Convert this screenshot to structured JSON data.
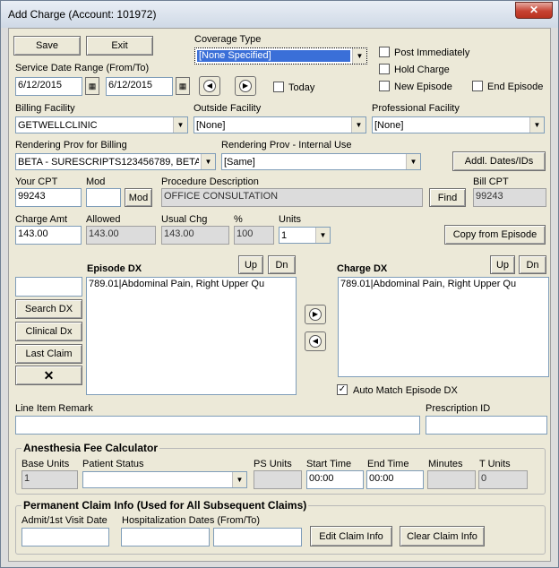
{
  "window": {
    "title": "Add Charge (Account: 101972)",
    "close_label": "✕"
  },
  "toolbar": {
    "save_label": "Save",
    "exit_label": "Exit"
  },
  "service_date": {
    "label": "Service Date Range (From/To)",
    "from": "6/12/2015",
    "to": "6/12/2015",
    "today_label": "Today"
  },
  "coverage": {
    "label": "Coverage Type",
    "value": "[None Specified]"
  },
  "options": {
    "post_immediately": "Post Immediately",
    "hold_charge": "Hold Charge",
    "new_episode": "New Episode",
    "end_episode": "End Episode"
  },
  "facilities": {
    "billing_label": "Billing Facility",
    "billing_value": "GETWELLCLINIC",
    "outside_label": "Outside Facility",
    "outside_value": "[None]",
    "professional_label": "Professional Facility",
    "professional_value": "[None]"
  },
  "rendering": {
    "billing_label": "Rendering Prov for Billing",
    "billing_value": "BETA - SURESCRIPTS123456789, BETA",
    "internal_label": "Rendering Prov - Internal Use",
    "internal_value": "[Same]",
    "addl_button": "Addl. Dates/IDs"
  },
  "cpt": {
    "your_cpt_label": "Your CPT",
    "your_cpt_value": "99243",
    "mod_label": "Mod",
    "mod_value": "",
    "mod_button": "Mod",
    "desc_label": "Procedure Description",
    "desc_value": "OFFICE CONSULTATION",
    "find_button": "Find",
    "bill_cpt_label": "Bill CPT",
    "bill_cpt_value": "99243"
  },
  "amounts": {
    "charge_label": "Charge Amt",
    "charge_value": "143.00",
    "allowed_label": "Allowed",
    "allowed_value": "143.00",
    "usual_label": "Usual Chg",
    "usual_value": "143.00",
    "pct_label": "%",
    "pct_value": "100",
    "units_label": "Units",
    "units_value": "1",
    "copy_button": "Copy from Episode"
  },
  "episode_dx": {
    "label": "Episode DX",
    "up": "Up",
    "dn": "Dn",
    "items": [
      "789.01|Abdominal Pain, Right Upper Qu"
    ]
  },
  "charge_dx": {
    "label": "Charge DX",
    "up": "Up",
    "dn": "Dn",
    "items": [
      "789.01|Abdominal Pain, Right Upper Qu"
    ],
    "auto_match_label": "Auto Match Episode DX"
  },
  "dx_buttons": {
    "search": "Search DX",
    "clinical": "Clinical Dx",
    "last_claim": "Last Claim",
    "delete": "✕",
    "search_value": ""
  },
  "remarks": {
    "line_item_label": "Line Item Remark",
    "line_item_value": "",
    "prescription_label": "Prescription ID",
    "prescription_value": ""
  },
  "anesthesia": {
    "title": "Anesthesia Fee Calculator",
    "base_units_label": "Base Units",
    "base_units_value": "1",
    "patient_status_label": "Patient Status",
    "patient_status_value": "",
    "ps_units_label": "PS Units",
    "ps_units_value": "",
    "start_time_label": "Start Time",
    "start_time_value": "00:00",
    "end_time_label": "End Time",
    "end_time_value": "00:00",
    "minutes_label": "Minutes",
    "minutes_value": "",
    "t_units_label": "T Units",
    "t_units_value": "0"
  },
  "permanent": {
    "title": "Permanent Claim Info (Used for All Subsequent Claims)",
    "admit_label": "Admit/1st Visit Date",
    "admit_value": "",
    "hosp_label": "Hospitalization Dates (From/To)",
    "hosp_from": "",
    "hosp_to": "",
    "edit_button": "Edit Claim Info",
    "clear_button": "Clear Claim Info"
  }
}
